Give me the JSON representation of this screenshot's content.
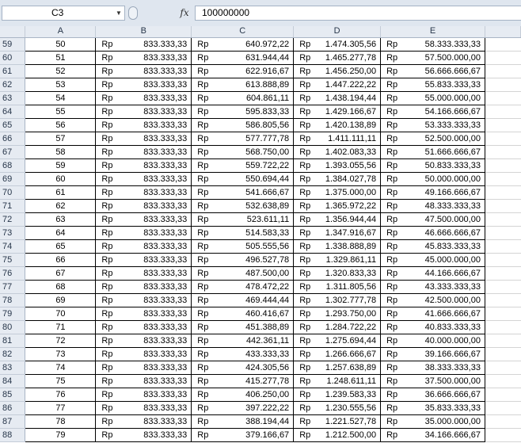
{
  "formula_bar": {
    "cell_ref": "C3",
    "fx_label": "fx",
    "formula": "100000000"
  },
  "columns": [
    "A",
    "B",
    "C",
    "D",
    "E"
  ],
  "currency": "Rp",
  "rows": [
    {
      "row": "59",
      "a": "50",
      "b": "833.333,33",
      "c": "640.972,22",
      "d": "1.474.305,56",
      "e": "58.333.333,33"
    },
    {
      "row": "60",
      "a": "51",
      "b": "833.333,33",
      "c": "631.944,44",
      "d": "1.465.277,78",
      "e": "57.500.000,00"
    },
    {
      "row": "61",
      "a": "52",
      "b": "833.333,33",
      "c": "622.916,67",
      "d": "1.456.250,00",
      "e": "56.666.666,67"
    },
    {
      "row": "62",
      "a": "53",
      "b": "833.333,33",
      "c": "613.888,89",
      "d": "1.447.222,22",
      "e": "55.833.333,33"
    },
    {
      "row": "63",
      "a": "54",
      "b": "833.333,33",
      "c": "604.861,11",
      "d": "1.438.194,44",
      "e": "55.000.000,00"
    },
    {
      "row": "64",
      "a": "55",
      "b": "833.333,33",
      "c": "595.833,33",
      "d": "1.429.166,67",
      "e": "54.166.666,67"
    },
    {
      "row": "65",
      "a": "56",
      "b": "833.333,33",
      "c": "586.805,56",
      "d": "1.420.138,89",
      "e": "53.333.333,33"
    },
    {
      "row": "66",
      "a": "57",
      "b": "833.333,33",
      "c": "577.777,78",
      "d": "1.411.111,11",
      "e": "52.500.000,00"
    },
    {
      "row": "67",
      "a": "58",
      "b": "833.333,33",
      "c": "568.750,00",
      "d": "1.402.083,33",
      "e": "51.666.666,67"
    },
    {
      "row": "68",
      "a": "59",
      "b": "833.333,33",
      "c": "559.722,22",
      "d": "1.393.055,56",
      "e": "50.833.333,33"
    },
    {
      "row": "69",
      "a": "60",
      "b": "833.333,33",
      "c": "550.694,44",
      "d": "1.384.027,78",
      "e": "50.000.000,00"
    },
    {
      "row": "70",
      "a": "61",
      "b": "833.333,33",
      "c": "541.666,67",
      "d": "1.375.000,00",
      "e": "49.166.666,67"
    },
    {
      "row": "71",
      "a": "62",
      "b": "833.333,33",
      "c": "532.638,89",
      "d": "1.365.972,22",
      "e": "48.333.333,33"
    },
    {
      "row": "72",
      "a": "63",
      "b": "833.333,33",
      "c": "523.611,11",
      "d": "1.356.944,44",
      "e": "47.500.000,00"
    },
    {
      "row": "73",
      "a": "64",
      "b": "833.333,33",
      "c": "514.583,33",
      "d": "1.347.916,67",
      "e": "46.666.666,67"
    },
    {
      "row": "74",
      "a": "65",
      "b": "833.333,33",
      "c": "505.555,56",
      "d": "1.338.888,89",
      "e": "45.833.333,33"
    },
    {
      "row": "75",
      "a": "66",
      "b": "833.333,33",
      "c": "496.527,78",
      "d": "1.329.861,11",
      "e": "45.000.000,00"
    },
    {
      "row": "76",
      "a": "67",
      "b": "833.333,33",
      "c": "487.500,00",
      "d": "1.320.833,33",
      "e": "44.166.666,67"
    },
    {
      "row": "77",
      "a": "68",
      "b": "833.333,33",
      "c": "478.472,22",
      "d": "1.311.805,56",
      "e": "43.333.333,33"
    },
    {
      "row": "78",
      "a": "69",
      "b": "833.333,33",
      "c": "469.444,44",
      "d": "1.302.777,78",
      "e": "42.500.000,00"
    },
    {
      "row": "79",
      "a": "70",
      "b": "833.333,33",
      "c": "460.416,67",
      "d": "1.293.750,00",
      "e": "41.666.666,67"
    },
    {
      "row": "80",
      "a": "71",
      "b": "833.333,33",
      "c": "451.388,89",
      "d": "1.284.722,22",
      "e": "40.833.333,33"
    },
    {
      "row": "81",
      "a": "72",
      "b": "833.333,33",
      "c": "442.361,11",
      "d": "1.275.694,44",
      "e": "40.000.000,00"
    },
    {
      "row": "82",
      "a": "73",
      "b": "833.333,33",
      "c": "433.333,33",
      "d": "1.266.666,67",
      "e": "39.166.666,67"
    },
    {
      "row": "83",
      "a": "74",
      "b": "833.333,33",
      "c": "424.305,56",
      "d": "1.257.638,89",
      "e": "38.333.333,33"
    },
    {
      "row": "84",
      "a": "75",
      "b": "833.333,33",
      "c": "415.277,78",
      "d": "1.248.611,11",
      "e": "37.500.000,00"
    },
    {
      "row": "85",
      "a": "76",
      "b": "833.333,33",
      "c": "406.250,00",
      "d": "1.239.583,33",
      "e": "36.666.666,67"
    },
    {
      "row": "86",
      "a": "77",
      "b": "833.333,33",
      "c": "397.222,22",
      "d": "1.230.555,56",
      "e": "35.833.333,33"
    },
    {
      "row": "87",
      "a": "78",
      "b": "833.333,33",
      "c": "388.194,44",
      "d": "1.221.527,78",
      "e": "35.000.000,00"
    },
    {
      "row": "88",
      "a": "79",
      "b": "833.333,33",
      "c": "379.166,67",
      "d": "1.212.500,00",
      "e": "34.166.666,67"
    }
  ]
}
